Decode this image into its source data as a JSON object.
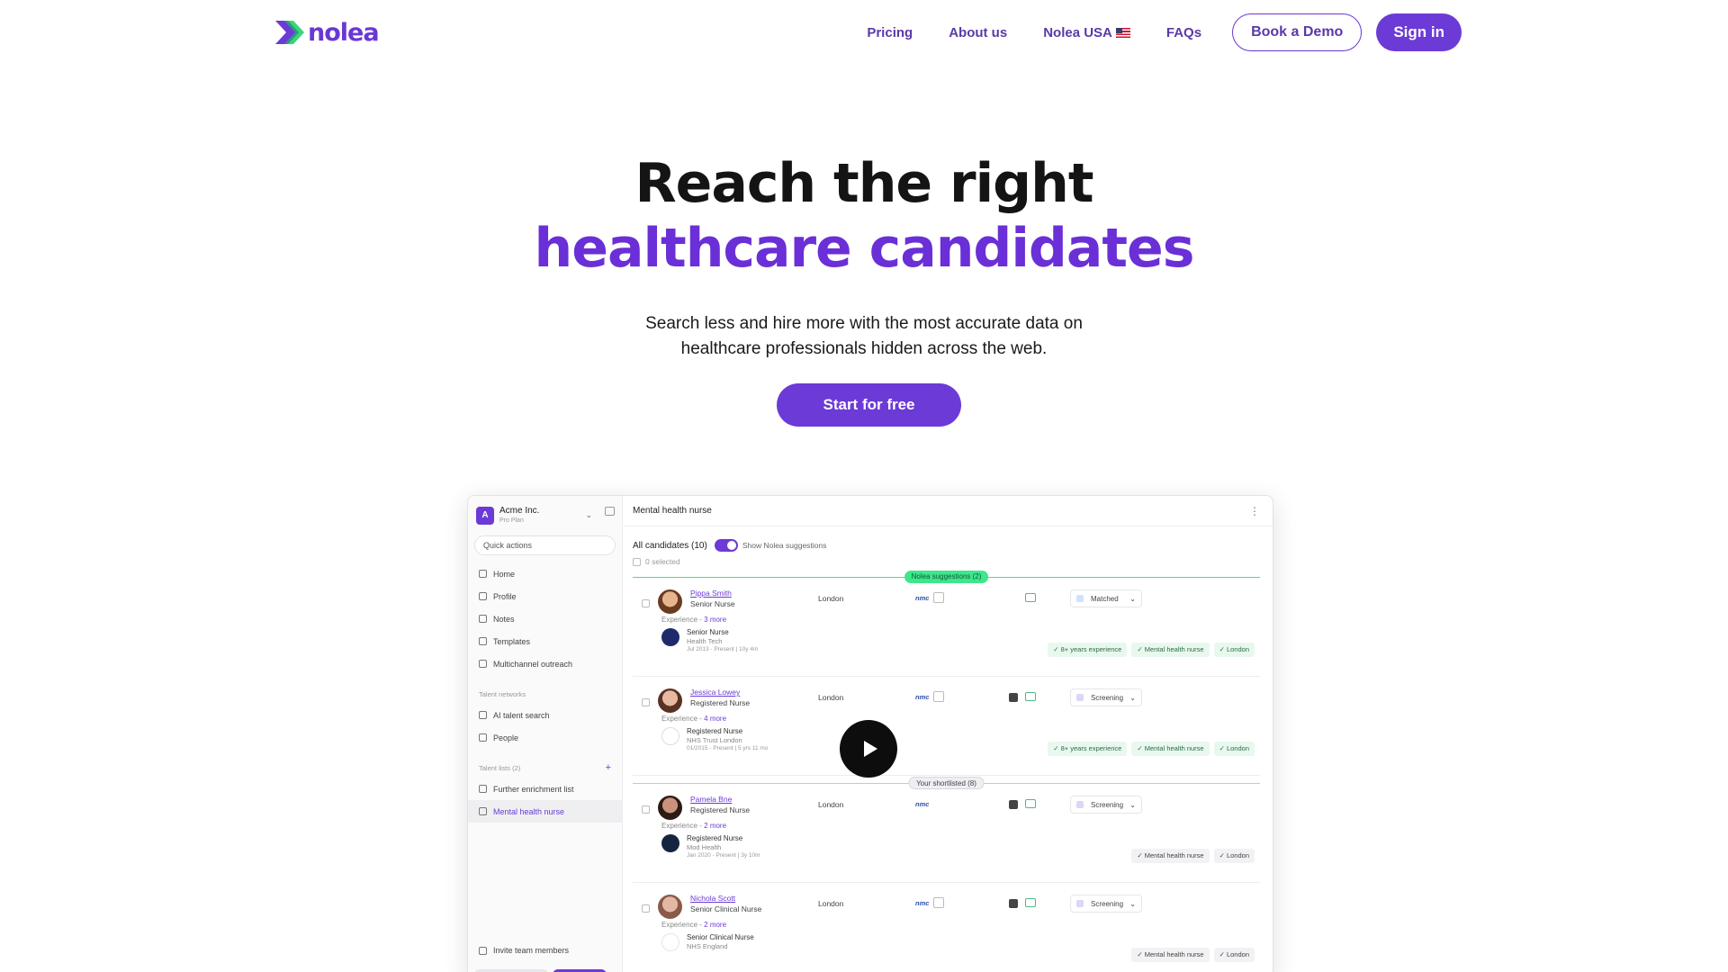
{
  "brand": {
    "name": "nolea",
    "primary": "#6c3ad6",
    "accent": "#32d46e"
  },
  "nav": {
    "links": [
      "Pricing",
      "About us",
      "Nolea USA",
      "FAQs"
    ],
    "demo_label": "Book a Demo",
    "signin_label": "Sign in"
  },
  "hero": {
    "line1": "Reach the right",
    "line2": "healthcare candidates",
    "sub1": "Search less and hire more with the most accurate data on",
    "sub2": "healthcare professionals hidden across the web.",
    "cta": "Start for free"
  },
  "app": {
    "org": {
      "name": "Acme Inc.",
      "plan": "Pro Plan",
      "badge": "A"
    },
    "quick_actions": "Quick actions",
    "nav": [
      "Home",
      "Profile",
      "Notes",
      "Templates",
      "Multichannel outreach"
    ],
    "talent_networks_label": "Talent networks",
    "talent_networks": [
      "AI talent search",
      "People"
    ],
    "talent_lists_label": "Talent lists (2)",
    "talent_lists": [
      "Further enrichment list",
      "Mental health nurse"
    ],
    "invite": "Invite team members",
    "list_title": "Mental health nurse",
    "all_candidates": "All candidates (10)",
    "show_suggestions": "Show Nolea suggestions",
    "selected": "0 selected",
    "suggestions_pill": "Nolea suggestions (2)",
    "shortlisted_pill": "Your shortlisted (8)",
    "experience_label": "Experience",
    "candidates": [
      {
        "name": "Pippa Smith",
        "role": "Senior Nurse",
        "location": "London",
        "badge": "nmc",
        "status": "Matched",
        "more": "3 more",
        "job_title": "Senior Nurse",
        "job_org": "Health Tech",
        "job_dates": "Jul 2013 - Present | 10y 4m",
        "tags": [
          "8+ years experience",
          "Mental health nurse",
          "London"
        ]
      },
      {
        "name": "Jessica Lowey",
        "role": "Registered Nurse",
        "location": "London",
        "badge": "nmc",
        "status": "Screening",
        "more": "4 more",
        "job_title": "Registered Nurse",
        "job_org": "NHS Trust London",
        "job_dates": "01/2015 - Present | 5 yrs 11 mo",
        "tags": [
          "8+ years experience",
          "Mental health nurse",
          "London"
        ]
      },
      {
        "name": "Pamela Bne",
        "role": "Registered Nurse",
        "location": "London",
        "badge": "nmc",
        "status": "Screening",
        "more": "2 more",
        "job_title": "Registered Nurse",
        "job_org": "Mod Health",
        "job_dates": "Jan 2020 - Present | 3y 10m",
        "tags": [
          "Mental health nurse",
          "London"
        ]
      },
      {
        "name": "Nichola Scott",
        "role": "Senior Clinical Nurse",
        "location": "London",
        "badge": "nmc",
        "status": "Screening",
        "more": "2 more",
        "job_title": "Senior Clinical Nurse",
        "job_org": "NHS England",
        "job_dates": "",
        "tags": [
          "Mental health nurse",
          "London"
        ]
      }
    ]
  }
}
